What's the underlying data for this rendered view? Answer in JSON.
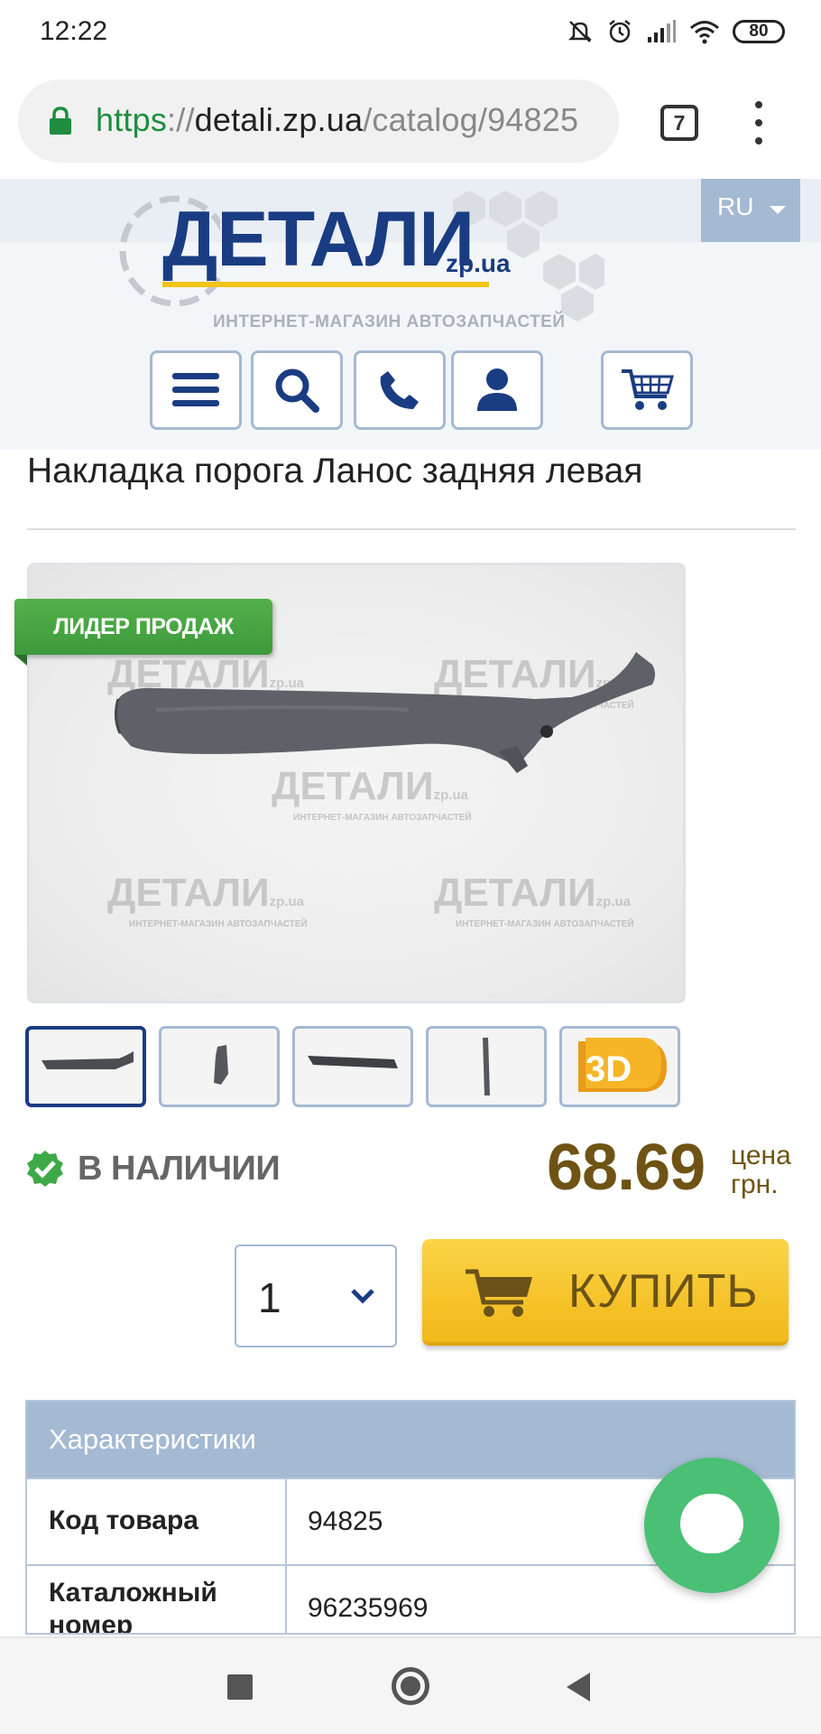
{
  "status_bar": {
    "time": "12:22",
    "battery": "80",
    "icons": [
      "mute-icon",
      "alarm-icon",
      "signal-icon",
      "wifi-icon",
      "battery-icon"
    ]
  },
  "browser": {
    "url_scheme": "https",
    "url_sep": "://",
    "url_host": "detali.zp.ua",
    "url_path": "/catalog/94825",
    "tab_count": "7"
  },
  "header": {
    "lang": "RU",
    "logo_title": "ДЕТАЛИ",
    "logo_sub": "zp.ua",
    "logo_tagline": "ИНТЕРНЕТ-МАГАЗИН АВТОЗАПЧАСТЕЙ",
    "nav_icons": [
      "menu-icon",
      "search-icon",
      "phone-icon",
      "user-icon",
      "cart-icon"
    ]
  },
  "product": {
    "title": "Накладка порога Ланос задняя левая",
    "badge": "ЛИДЕР ПРОДАЖ",
    "watermark_title": "ДЕТАЛИ",
    "watermark_sub": "zp.ua",
    "watermark_tag": "ИНТЕРНЕТ-МАГАЗИН АВТОЗАПЧАСТЕЙ",
    "thumbnail_3d_label": "3D",
    "stock_label": "В НАЛИЧИИ",
    "price": "68.69",
    "price_caption_1": "цена",
    "price_caption_2": "грн.",
    "quantity": "1",
    "buy_label": "КУПИТЬ"
  },
  "specs": {
    "heading": "Характеристики",
    "rows": [
      {
        "key": "Код товара",
        "value": "94825"
      },
      {
        "key": "Каталожный номер",
        "value": "96235969"
      }
    ]
  },
  "colors": {
    "brand_blue": "#1a3c82",
    "accent_yellow": "#f1b818",
    "badge_green": "#3d9a3a",
    "chat_green": "#49c074",
    "price_brown": "#6e5314",
    "header_blue": "#a4b9d2"
  }
}
